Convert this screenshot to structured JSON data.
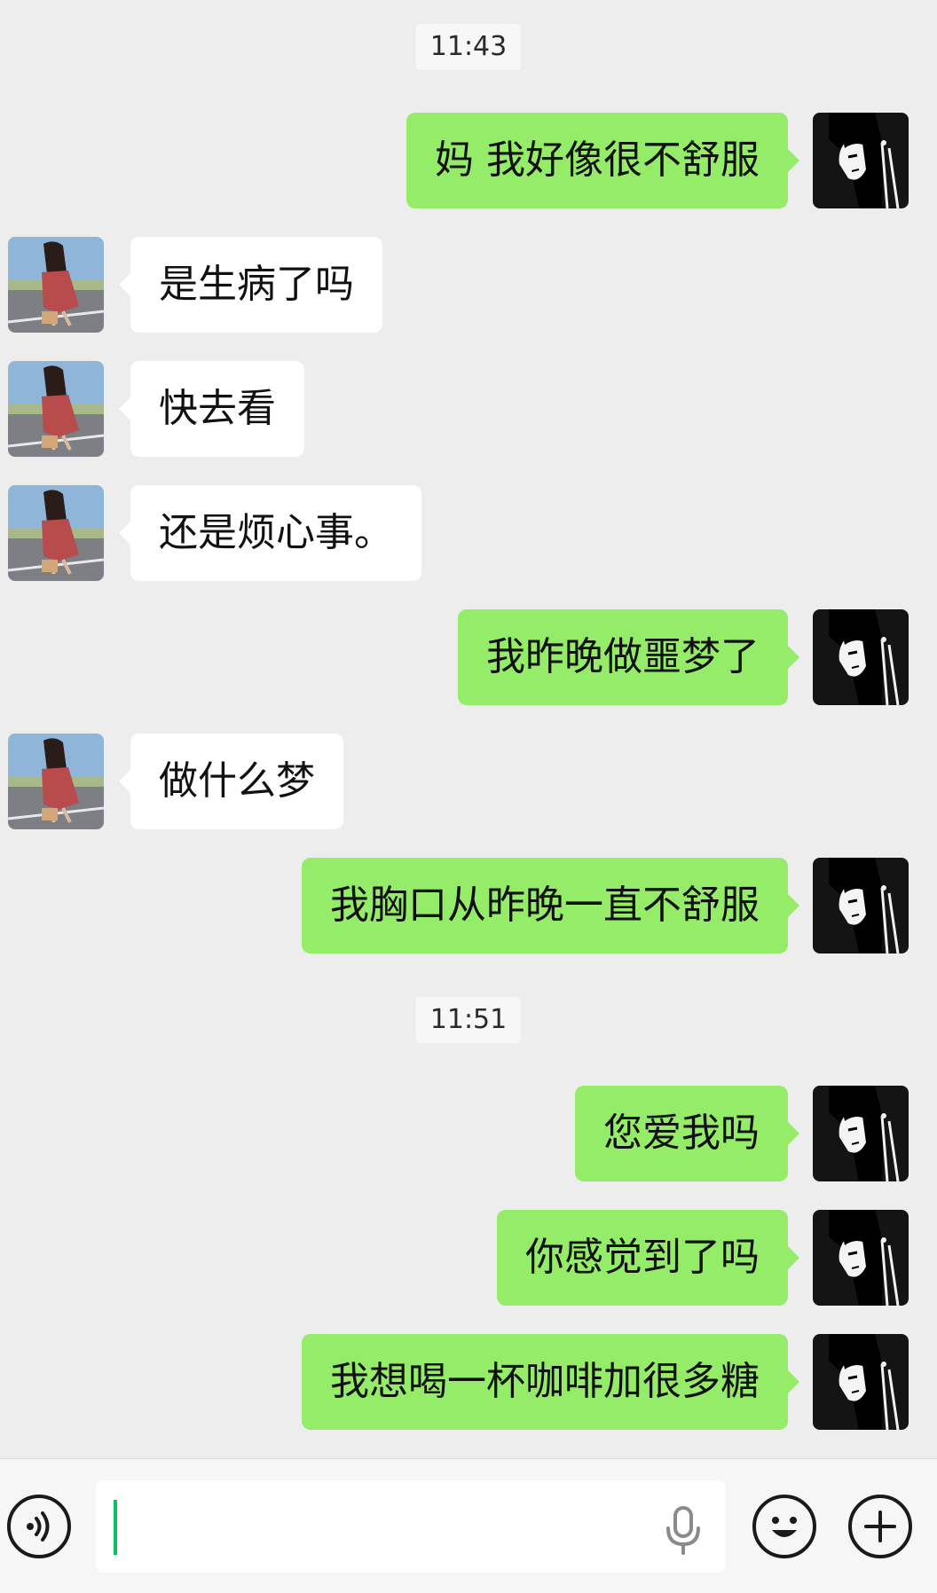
{
  "timestamps": [
    "11:43",
    "11:51"
  ],
  "messages": [
    {
      "from": "me",
      "text": "妈 我好像很不舒服"
    },
    {
      "from": "them",
      "text": "是生病了吗"
    },
    {
      "from": "them",
      "text": "快去看"
    },
    {
      "from": "them",
      "text": "还是烦心事。"
    },
    {
      "from": "me",
      "text": "我昨晚做噩梦了"
    },
    {
      "from": "them",
      "text": "做什么梦"
    },
    {
      "from": "me",
      "text": "我胸口从昨晚一直不舒服"
    },
    {
      "from": "me",
      "text": "您爱我吗"
    },
    {
      "from": "me",
      "text": "你感觉到了吗"
    },
    {
      "from": "me",
      "text": "我想喝一杯咖啡加很多糖"
    }
  ],
  "input": {
    "value": "",
    "icons": {
      "voice": "voice-mode-icon",
      "mic": "microphone-icon",
      "emoji": "emoji-icon",
      "more": "plus-icon"
    }
  },
  "colors": {
    "background": "#ededed",
    "my_bubble": "#95ec69",
    "their_bubble": "#ffffff",
    "caret": "#07c160"
  }
}
